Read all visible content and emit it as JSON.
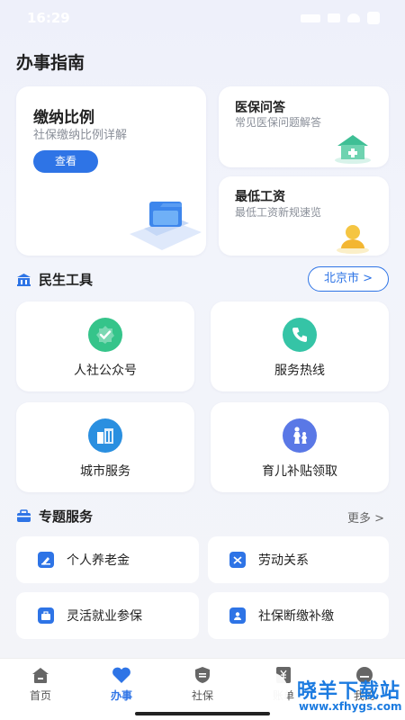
{
  "status": {
    "time": "16:29"
  },
  "header": {
    "title": "办事指南"
  },
  "guide_cards": {
    "ratio": {
      "title": "缴纳比例",
      "subtitle": "社保缴纳比例详解",
      "button": "查看"
    },
    "medical": {
      "title": "医保问答",
      "subtitle": "常见医保问题解答"
    },
    "wage": {
      "title": "最低工资",
      "subtitle": "最低工资新规速览"
    }
  },
  "tools_section": {
    "title": "民生工具",
    "city": "北京市 >",
    "items": [
      {
        "label": "人社公众号",
        "icon": "verified-badge-icon",
        "color": "#35c48a"
      },
      {
        "label": "服务热线",
        "icon": "phone-icon",
        "color": "#35c4a6"
      },
      {
        "label": "城市服务",
        "icon": "building-icon",
        "color": "#2a8fe0"
      },
      {
        "label": "育儿补贴领取",
        "icon": "family-icon",
        "color": "#5a78e6"
      }
    ]
  },
  "topic_section": {
    "title": "专题服务",
    "more": "更多 >",
    "items": [
      {
        "label": "个人养老金",
        "icon": "pension-icon"
      },
      {
        "label": "劳动关系",
        "icon": "labor-icon"
      },
      {
        "label": "灵活就业参保",
        "icon": "briefcase-icon"
      },
      {
        "label": "社保断缴补缴",
        "icon": "id-card-icon"
      }
    ]
  },
  "tabbar": {
    "items": [
      {
        "label": "首页",
        "icon": "home-icon"
      },
      {
        "label": "办事",
        "icon": "heart-icon",
        "active": true
      },
      {
        "label": "社保",
        "icon": "shield-icon"
      },
      {
        "label": "账单",
        "icon": "yen-bill-icon"
      },
      {
        "label": "我的",
        "icon": "user-icon"
      }
    ]
  },
  "watermark": {
    "text": "晓羊下载站",
    "url": "www.xfhygs.com"
  }
}
